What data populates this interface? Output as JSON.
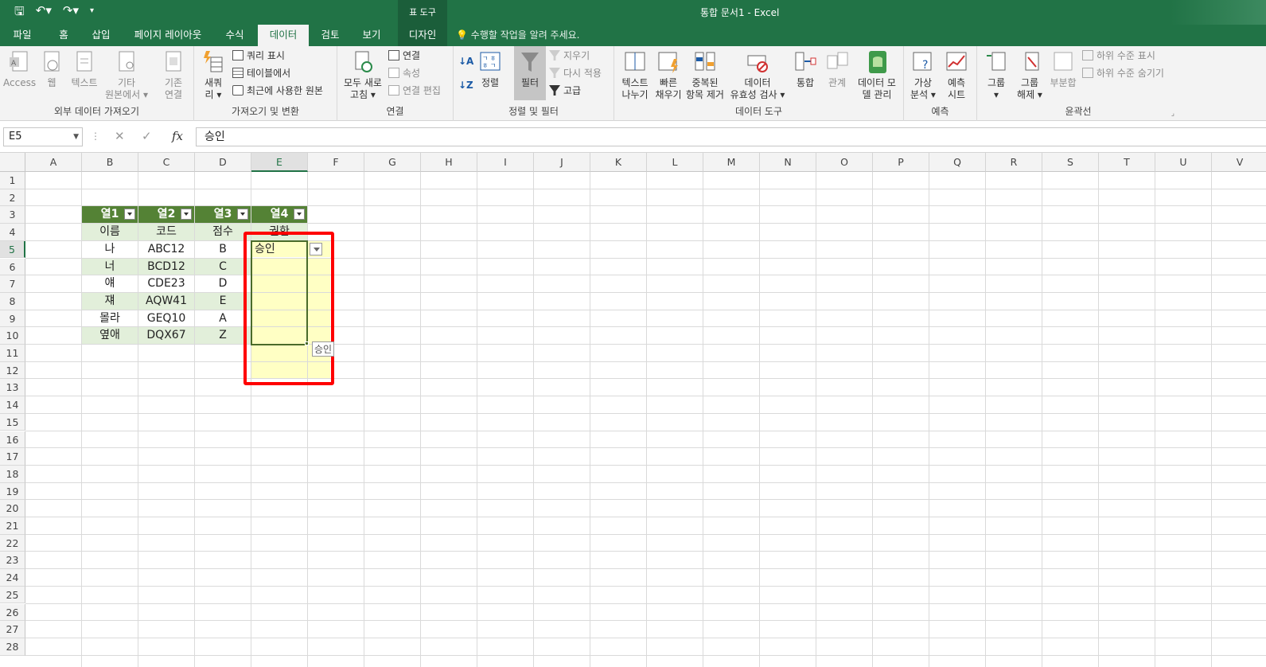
{
  "titlebar": {
    "context_tab_group": "표 도구",
    "title": "통합 문서1 - Excel"
  },
  "tabs": [
    {
      "label": "파일"
    },
    {
      "label": "홈"
    },
    {
      "label": "삽입"
    },
    {
      "label": "페이지 레이아웃"
    },
    {
      "label": "수식"
    },
    {
      "label": "데이터"
    },
    {
      "label": "검토"
    },
    {
      "label": "보기"
    },
    {
      "label": "디자인"
    }
  ],
  "tellme": "수행할 작업을 알려 주세요.",
  "ribbon": {
    "external": {
      "label": "외부 데이터 가져오기",
      "access": "Access",
      "web": "웹",
      "text": "텍스트",
      "other1": "기타",
      "other2": "원본에서 ▾"
    },
    "transform": {
      "label": "가져오기 및 변환",
      "conn1": "기존",
      "conn2": "연결",
      "newq1": "새쿼",
      "newq2": "리 ▾",
      "show_query": "쿼리 표시",
      "from_table": "테이블에서",
      "recent": "최근에 사용한 원본"
    },
    "connections": {
      "label": "연결",
      "refresh1": "모두 새로",
      "refresh2": "고침 ▾",
      "conn": "연결",
      "props": "속성",
      "edit": "연결 편집"
    },
    "sortfilter": {
      "label": "정렬 및 필터",
      "sort": "정렬",
      "filter": "필터",
      "clear": "지우기",
      "reapply": "다시 적용",
      "advanced": "고급"
    },
    "datatools": {
      "label": "데이터 도구",
      "text1": "텍스트",
      "text2": "나누기",
      "flash1": "빠른",
      "flash2": "채우기",
      "dup1": "중복된",
      "dup2": "항목 제거",
      "valid1": "데이터",
      "valid2": "유효성 검사 ▾",
      "consol": "통합",
      "rel": "관계",
      "model1": "데이터 모",
      "model2": "델 관리"
    },
    "forecast": {
      "label": "예측",
      "whatif1": "가상",
      "whatif2": "분석 ▾",
      "sheet1": "예측",
      "sheet2": "시트"
    },
    "outline": {
      "label": "윤곽선",
      "group1": "그룹",
      "group2": "▾",
      "ungroup1": "그룹",
      "ungroup2": "해제 ▾",
      "subtotal": "부분합",
      "show": "하위 수준 표시",
      "hide": "하위 수준 숨기기"
    }
  },
  "formulabar": {
    "namebox": "E5",
    "cancel": "✕",
    "enter": "✓",
    "fx": "fx",
    "value": "승인"
  },
  "columns": [
    "A",
    "B",
    "C",
    "D",
    "E",
    "F",
    "G",
    "H",
    "I",
    "J",
    "K",
    "L",
    "M",
    "N",
    "O",
    "P",
    "Q",
    "R",
    "S",
    "T",
    "U",
    "V"
  ],
  "rows": [
    "1",
    "2",
    "3",
    "4",
    "5",
    "6",
    "7",
    "8",
    "9",
    "10",
    "11",
    "12",
    "13",
    "14",
    "15",
    "16",
    "17",
    "18",
    "19",
    "20",
    "21",
    "22",
    "23",
    "24",
    "25",
    "26",
    "27",
    "28"
  ],
  "table": {
    "headers": [
      "열1",
      "열2",
      "열3",
      "열4"
    ],
    "rows": [
      [
        "이름",
        "코드",
        "점수",
        "권한"
      ],
      [
        "나",
        "ABC12",
        "B",
        "승인"
      ],
      [
        "너",
        "BCD12",
        "C",
        ""
      ],
      [
        "얘",
        "CDE23",
        "D",
        ""
      ],
      [
        "쟤",
        "AQW41",
        "E",
        ""
      ],
      [
        "몰라",
        "GEQ10",
        "A",
        ""
      ],
      [
        "옆애",
        "DQX67",
        "Z",
        ""
      ]
    ]
  },
  "tooltip": "승인",
  "colors": {
    "accent": "#217346",
    "table_header": "#548235",
    "band": "#e2efda",
    "highlight_box": "#ff0000",
    "validation_fill": "#ffffc4"
  }
}
